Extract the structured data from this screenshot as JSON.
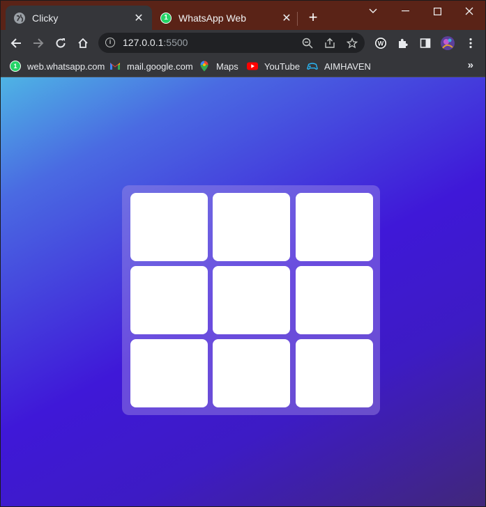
{
  "browser": {
    "tabs": [
      {
        "title": "Clicky",
        "favicon": "globe-icon",
        "active": true
      },
      {
        "title": "WhatsApp Web",
        "favicon": "whatsapp-icon",
        "badge": "1",
        "active": false
      }
    ],
    "new_tab_glyph": "+",
    "close_glyph": "✕",
    "window_controls": {
      "collapse": "⌄",
      "minimize": "—",
      "maximize": "☐",
      "close": "✕"
    },
    "nav": {
      "back": "←",
      "forward": "→",
      "reload": "↻",
      "home": "⌂"
    },
    "address": {
      "host": "127.0.0.1",
      "port": ":5500",
      "info_glyph": "i"
    },
    "omnibox_icons": {
      "zoom": "zoom-out-icon",
      "share": "share-icon",
      "bookmark": "star-icon"
    },
    "extension_icons": [
      "wappalyzer-icon",
      "puzzle-extensions-icon",
      "side-panel-icon",
      "profile-avatar",
      "kebab-menu-icon"
    ],
    "bookmarks": [
      {
        "label": "web.whatsapp.com",
        "icon": "whatsapp-icon",
        "badge": "1"
      },
      {
        "label": "mail.google.com",
        "icon": "gmail-icon"
      },
      {
        "label": "Maps",
        "icon": "maps-pin-icon"
      },
      {
        "label": "YouTube",
        "icon": "youtube-icon"
      },
      {
        "label": "AIMHAVEN",
        "icon": "gamepad-icon"
      }
    ],
    "bookmarks_more": "»"
  },
  "colors": {
    "titlebar": "#5a2317",
    "toolbar": "#35363a",
    "gradient_start": "#4eb4e4",
    "gradient_mid": "#3f18d8",
    "gradient_end": "#41277a",
    "cell": "#ffffff"
  },
  "game": {
    "rows": 3,
    "cols": 3,
    "cells": [
      "",
      "",
      "",
      "",
      "",
      "",
      "",
      "",
      ""
    ]
  }
}
